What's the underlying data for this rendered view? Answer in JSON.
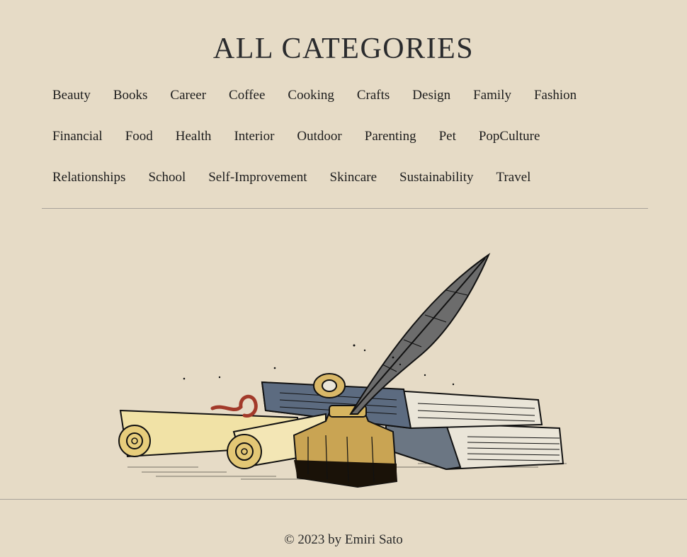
{
  "page": {
    "title": "ALL CATEGORIES"
  },
  "categories": {
    "row1": [
      "Beauty",
      "Books",
      "Career",
      "Coffee",
      "Cooking",
      "Crafts",
      "Design",
      "Family",
      "Fashion"
    ],
    "row2": [
      "Financial",
      "Food",
      "Health",
      "Interior",
      "Outdoor",
      "Parenting",
      "Pet",
      "PopCulture"
    ],
    "row3": [
      "Relationships",
      "School",
      "Self-Improvement",
      "Skincare",
      "Sustainability",
      "Travel"
    ]
  },
  "footer": {
    "text": "© 2023 by Emiri Sato"
  },
  "colors": {
    "background": "#e6dbc6",
    "text": "#1d1d1d",
    "divider": "#a8a29a"
  },
  "illustration": {
    "subject": "quill-inkwell-books-scrolls-illustration"
  }
}
